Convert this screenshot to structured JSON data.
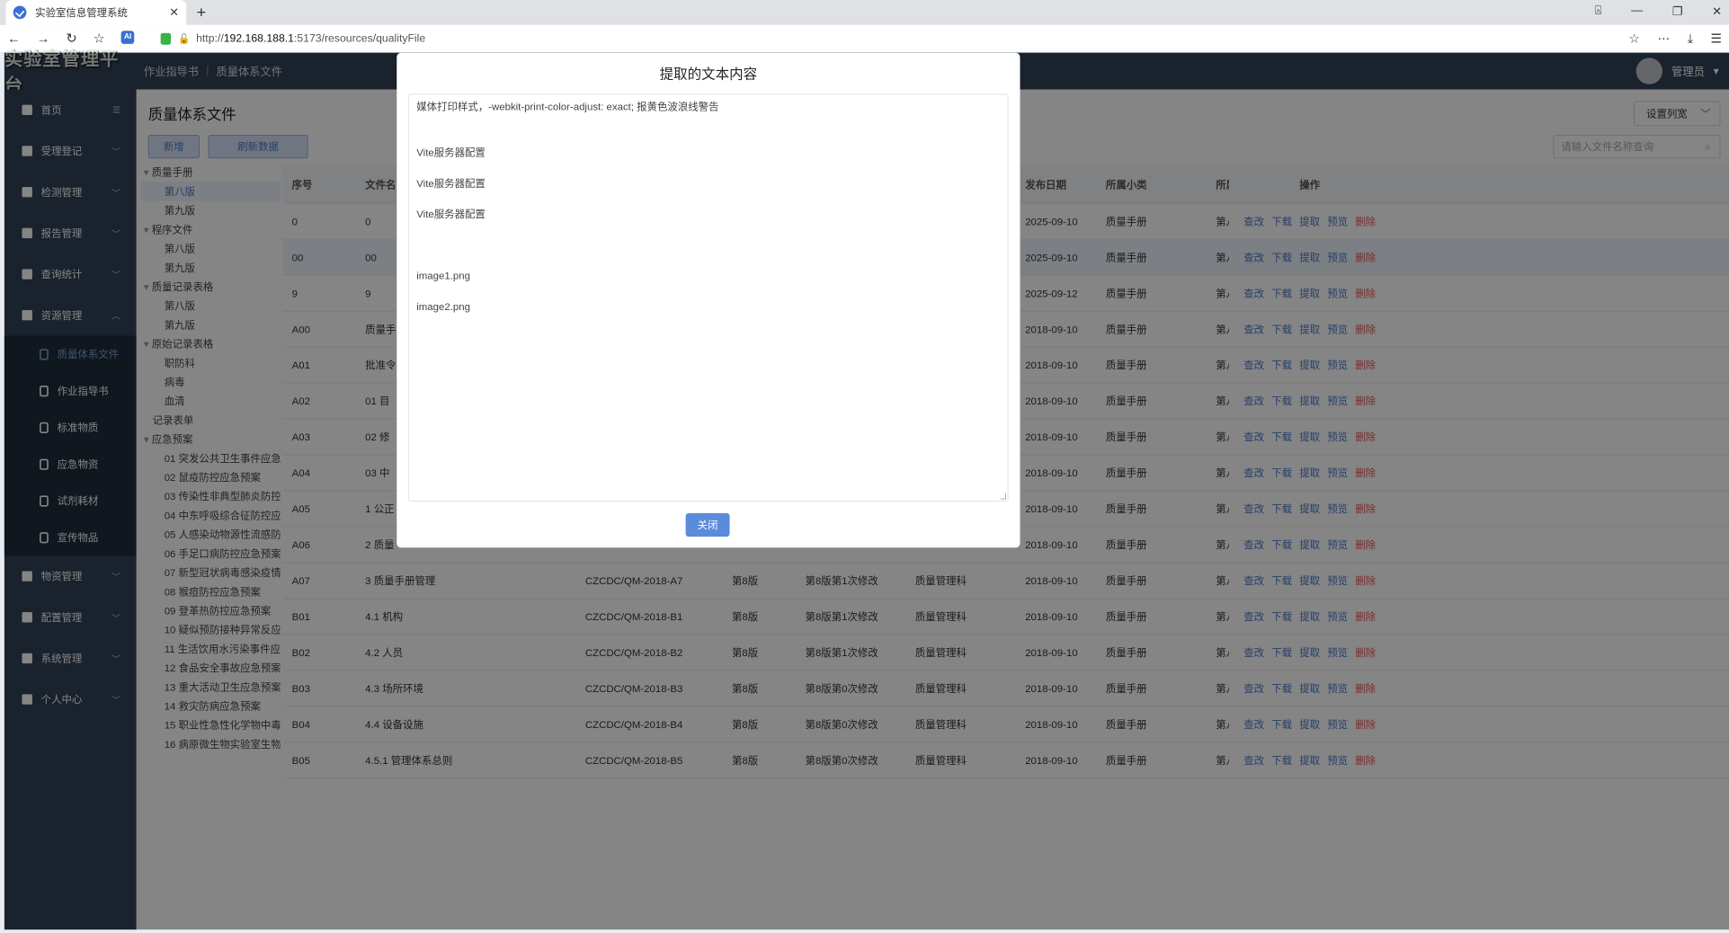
{
  "browser": {
    "tab_title": "实验室信息管理系统",
    "url_prefix": "http://",
    "url_host": "192.168.188.1",
    "url_rest": ":5173/resources/qualityFile"
  },
  "app": {
    "logo": "实验室管理平台",
    "breadcrumb": [
      "作业指导书",
      "质量体系文件"
    ],
    "user": "管理员"
  },
  "sidebar": {
    "items": [
      {
        "label": "首页"
      },
      {
        "label": "受理登记"
      },
      {
        "label": "检测管理"
      },
      {
        "label": "报告管理"
      },
      {
        "label": "查询统计"
      },
      {
        "label": "资源管理"
      }
    ],
    "sub_items": [
      "质量体系文件",
      "作业指导书",
      "标准物质",
      "应急物资",
      "试剂耗材",
      "宣传物品"
    ],
    "items_after": [
      {
        "label": "物资管理"
      },
      {
        "label": "配置管理"
      },
      {
        "label": "系统管理"
      },
      {
        "label": "个人中心"
      }
    ]
  },
  "main": {
    "title": "质量体系文件",
    "add_button": "新增",
    "refresh_button": "刷新数据",
    "set_columns": "设置列宽",
    "search_placeholder": "请输入文件名称查询",
    "tree": [
      {
        "label": "质量手册",
        "level": 0
      },
      {
        "label": "第八版",
        "level": 1
      },
      {
        "label": "第九版",
        "level": 1
      },
      {
        "label": "程序文件",
        "level": 0
      },
      {
        "label": "第八版",
        "level": 1
      },
      {
        "label": "第九版",
        "level": 1
      },
      {
        "label": "质量记录表格",
        "level": 0
      },
      {
        "label": "第八版",
        "level": 1
      },
      {
        "label": "第九版",
        "level": 1
      },
      {
        "label": "原始记录表格",
        "level": 0
      },
      {
        "label": "职防科",
        "level": 1
      },
      {
        "label": "病毒",
        "level": 1
      },
      {
        "label": "血清",
        "level": 1
      },
      {
        "label": "记录表单",
        "level": 0
      },
      {
        "label": "应急预案",
        "level": 0
      },
      {
        "label": "01 突发公共卫生事件应急",
        "level": 1
      },
      {
        "label": "02 鼠疫防控应急预案",
        "level": 1
      },
      {
        "label": "03 传染性非典型肺炎防控",
        "level": 1
      },
      {
        "label": "04 中东呼吸综合征防控应",
        "level": 1
      },
      {
        "label": "05 人感染动物源性流感防",
        "level": 1
      },
      {
        "label": "06 手足口病防控应急预案",
        "level": 1
      },
      {
        "label": "07 新型冠状病毒感染疫情",
        "level": 1
      },
      {
        "label": "08 猴痘防控应急预案",
        "level": 1
      },
      {
        "label": "09 登革热防控应急预案",
        "level": 1
      },
      {
        "label": "10 疑似预防接种异常反应",
        "level": 1
      },
      {
        "label": "11 生活饮用水污染事件应",
        "level": 1
      },
      {
        "label": "12 食品安全事故应急预案",
        "level": 1
      },
      {
        "label": "13 重大活动卫生应急预案",
        "level": 1
      },
      {
        "label": "14 救灾防病应急预案",
        "level": 1
      },
      {
        "label": "15 职业性急性化学物中毒",
        "level": 1
      },
      {
        "label": "16 病原微生物实验室生物",
        "level": 1
      }
    ],
    "table": {
      "headers": [
        "序号",
        "文件名",
        "",
        "",
        "",
        "",
        "发布日期",
        "所属小类",
        "所属",
        "操作"
      ],
      "ops": [
        "查改",
        "下载",
        "提取",
        "预览",
        "删除"
      ],
      "rows": [
        [
          "0",
          "0",
          "",
          "",
          "",
          "",
          "2025-09-10",
          "质量手册",
          "第八"
        ],
        [
          "00",
          "00",
          "",
          "",
          "",
          "",
          "2025-09-10",
          "质量手册",
          "第八"
        ],
        [
          "9",
          "9",
          "",
          "",
          "",
          "",
          "2025-09-12",
          "质量手册",
          "第八"
        ],
        [
          "A00",
          "质量手",
          "",
          "",
          "",
          "",
          "2018-09-10",
          "质量手册",
          "第八"
        ],
        [
          "A01",
          "批准令",
          "",
          "",
          "",
          "",
          "2018-09-10",
          "质量手册",
          "第八"
        ],
        [
          "A02",
          "01 目",
          "",
          "",
          "",
          "",
          "2018-09-10",
          "质量手册",
          "第八"
        ],
        [
          "A03",
          "02 修",
          "",
          "",
          "",
          "",
          "2018-09-10",
          "质量手册",
          "第八"
        ],
        [
          "A04",
          "03 中",
          "",
          "",
          "",
          "",
          "2018-09-10",
          "质量手册",
          "第八"
        ],
        [
          "A05",
          "1 公正",
          "",
          "",
          "",
          "",
          "2018-09-10",
          "质量手册",
          "第八"
        ],
        [
          "A06",
          "2 质量",
          "",
          "",
          "",
          "",
          "2018-09-10",
          "质量手册",
          "第八"
        ],
        [
          "A07",
          "3 质量手册管理",
          "CZCDC/QM-2018-A7",
          "第8版",
          "第8版第1次修改",
          "质量管理科",
          "2018-09-10",
          "质量手册",
          "第八"
        ],
        [
          "B01",
          "4.1 机构",
          "CZCDC/QM-2018-B1",
          "第8版",
          "第8版第1次修改",
          "质量管理科",
          "2018-09-10",
          "质量手册",
          "第八"
        ],
        [
          "B02",
          "4.2 人员",
          "CZCDC/QM-2018-B2",
          "第8版",
          "第8版第1次修改",
          "质量管理科",
          "2018-09-10",
          "质量手册",
          "第八"
        ],
        [
          "B03",
          "4.3 场所环境",
          "CZCDC/QM-2018-B3",
          "第8版",
          "第8版第0次修改",
          "质量管理科",
          "2018-09-10",
          "质量手册",
          "第八"
        ],
        [
          "B04",
          "4.4 设备设施",
          "CZCDC/QM-2018-B4",
          "第8版",
          "第8版第0次修改",
          "质量管理科",
          "2018-09-10",
          "质量手册",
          "第八"
        ],
        [
          "B05",
          "4.5.1 管理体系总则",
          "CZCDC/QM-2018-B5",
          "第8版",
          "第8版第0次修改",
          "质量管理科",
          "2018-09-10",
          "质量手册",
          "第八"
        ]
      ]
    }
  },
  "modal": {
    "title": "提取的文本内容",
    "lines": [
      "媒体打印样式，-webkit-print-color-adjust: exact; 报黄色波浪线警告",
      "",
      "",
      "Vite服务器配置",
      "",
      "Vite服务器配置",
      "",
      "Vite服务器配置",
      "",
      "",
      "",
      "image1.png",
      "",
      "image2.png"
    ],
    "close_button": "关闭"
  }
}
